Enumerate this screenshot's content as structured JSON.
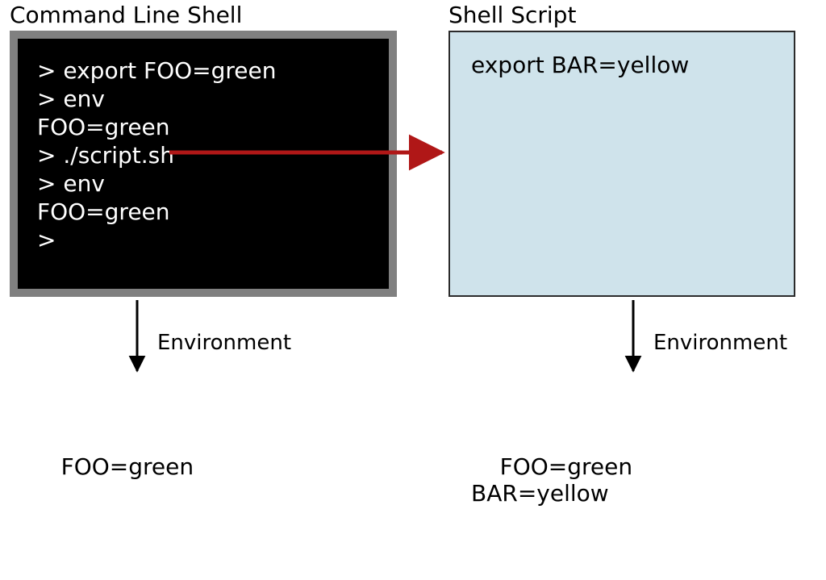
{
  "titles": {
    "shell": "Command Line Shell",
    "script": "Shell Script"
  },
  "terminal": {
    "lines": [
      "> export FOO=green",
      "> env",
      "FOO=green",
      "> ./script.sh",
      "> env",
      "FOO=green",
      ">"
    ]
  },
  "script": {
    "lines": [
      "export BAR=yellow"
    ]
  },
  "envLabel": "Environment",
  "envLeft": {
    "lines": [
      "FOO=green"
    ]
  },
  "envRight": {
    "lines": [
      "FOO=green",
      "BAR=yellow"
    ]
  },
  "colors": {
    "terminalFrame": "#808080",
    "terminalBg": "#000000",
    "terminalFg": "#ffffff",
    "scriptBg": "#cfe3eb",
    "scriptBorder": "#2b2b2b",
    "envFill": "#fce5b6",
    "envStroke": "#2b2b2b",
    "arrowRed": "#b01717",
    "arrowBlack": "#000000"
  }
}
